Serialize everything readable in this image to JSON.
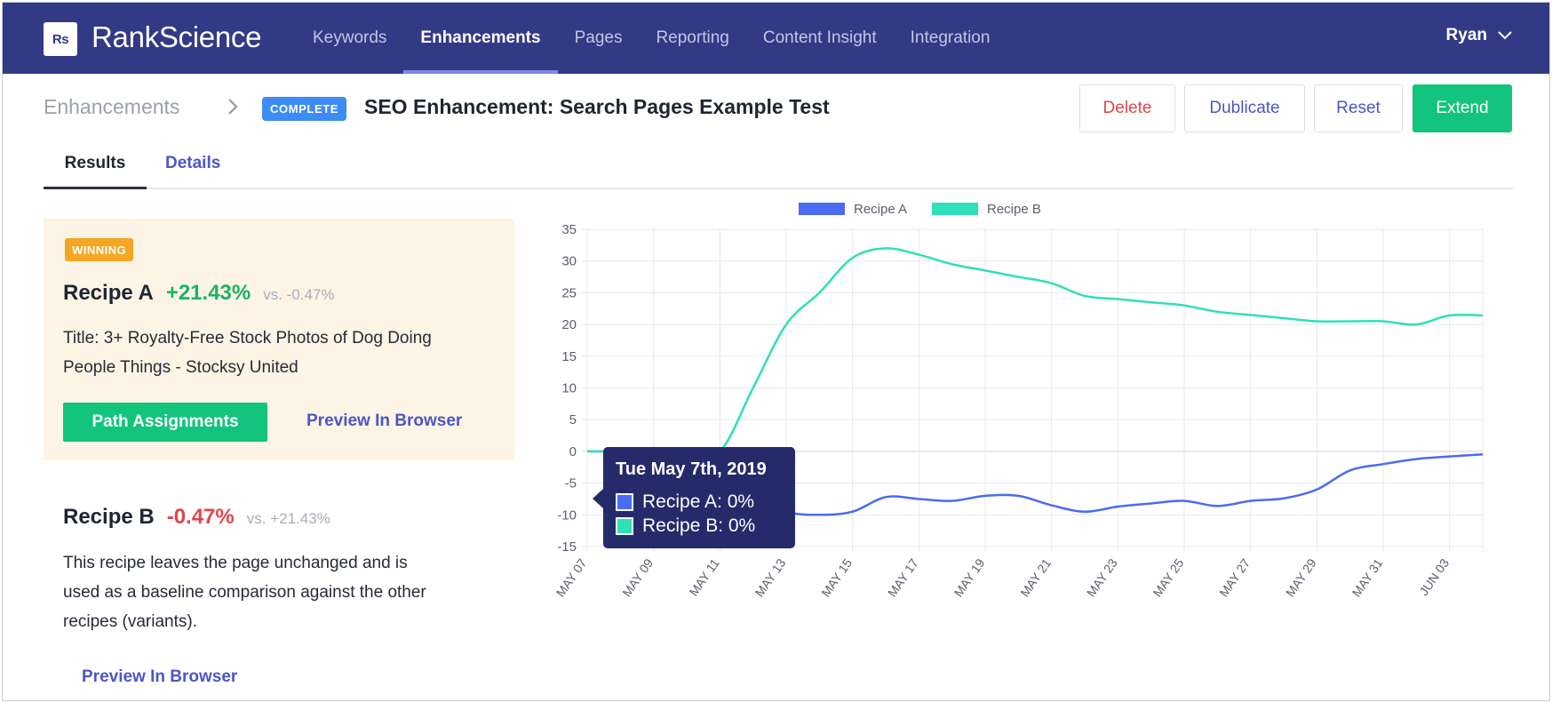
{
  "brand": {
    "logo_text": "Rs",
    "name": "RankScience"
  },
  "nav": {
    "items": [
      "Keywords",
      "Enhancements",
      "Pages",
      "Reporting",
      "Content Insight",
      "Integration"
    ],
    "active": "Enhancements",
    "user": "Ryan"
  },
  "header": {
    "breadcrumb": "Enhancements",
    "status_badge": "COMPLETE",
    "title": "SEO Enhancement: Search Pages Example Test",
    "buttons": {
      "delete": "Delete",
      "duplicate": "Dublicate",
      "reset": "Reset",
      "extend": "Extend"
    }
  },
  "tabs": {
    "results": "Results",
    "details": "Details",
    "active": "Results"
  },
  "recipe_a": {
    "badge": "WINNING",
    "name": "Recipe A",
    "change": "+21.43%",
    "vs": "vs. -0.47%",
    "desc_line1": "Title: 3+ Royalty-Free Stock Photos of Dog Doing",
    "desc_line2": "People Things - Stocksy United",
    "path_button": "Path Assignments",
    "preview_link": "Preview In Browser"
  },
  "recipe_b": {
    "name": "Recipe B",
    "change": "-0.47%",
    "vs": "vs. +21.43%",
    "desc_line1": "This recipe leaves the page unchanged and is",
    "desc_line2": "used as a baseline comparison against the other",
    "desc_line3": "recipes (variants).",
    "preview_link": "Preview In Browser"
  },
  "tooltip": {
    "date": "Tue May 7th, 2019",
    "row_a": "Recipe A: 0%",
    "row_b": "Recipe B: 0%"
  },
  "colors": {
    "nav_bg": "#323a86",
    "accent_green": "#13c47c",
    "recipe_a": "#4a6cf0",
    "recipe_b": "#2fe0b8"
  },
  "chart_data": {
    "type": "line",
    "x": [
      "2019-05-07",
      "2019-05-08",
      "2019-05-09",
      "2019-05-10",
      "2019-05-11",
      "2019-05-12",
      "2019-05-13",
      "2019-05-14",
      "2019-05-15",
      "2019-05-16",
      "2019-05-17",
      "2019-05-18",
      "2019-05-19",
      "2019-05-20",
      "2019-05-21",
      "2019-05-22",
      "2019-05-23",
      "2019-05-24",
      "2019-05-25",
      "2019-05-26",
      "2019-05-27",
      "2019-05-28",
      "2019-05-29",
      "2019-05-30",
      "2019-05-31",
      "2019-06-01",
      "2019-06-02",
      "2019-06-03"
    ],
    "tick_labels": [
      "MAY 07",
      "MAY 09",
      "MAY 11",
      "MAY 13",
      "MAY 15",
      "MAY 17",
      "MAY 19",
      "MAY 21",
      "MAY 23",
      "MAY 25",
      "MAY 27",
      "MAY 29",
      "MAY 31",
      "JUN 03"
    ],
    "series": [
      {
        "name": "Recipe A",
        "color": "#4a6cf0",
        "values": [
          0,
          0,
          0,
          0,
          0,
          -7,
          -9.5,
          -10,
          -9.5,
          -7.2,
          -7.5,
          -7.8,
          -7,
          -7,
          -8.5,
          -9.5,
          -8.7,
          -8.2,
          -7.8,
          -8.6,
          -7.8,
          -7.4,
          -6,
          -3,
          -2,
          -1.2,
          -0.8,
          -0.47
        ]
      },
      {
        "name": "Recipe B",
        "color": "#2fe0b8",
        "values": [
          0,
          0,
          0,
          0,
          0,
          10,
          20,
          25,
          30.5,
          32,
          31,
          29.5,
          28.5,
          27.5,
          26.5,
          24.5,
          24,
          23.5,
          23,
          22,
          21.5,
          21,
          20.5,
          20.5,
          20.5,
          20,
          21.43,
          21.43
        ]
      }
    ],
    "ylim": [
      -15,
      35
    ],
    "yticks": [
      -15,
      -10,
      -5,
      0,
      5,
      10,
      15,
      20,
      25,
      30,
      35
    ],
    "grid": true,
    "legend": "top-center"
  }
}
